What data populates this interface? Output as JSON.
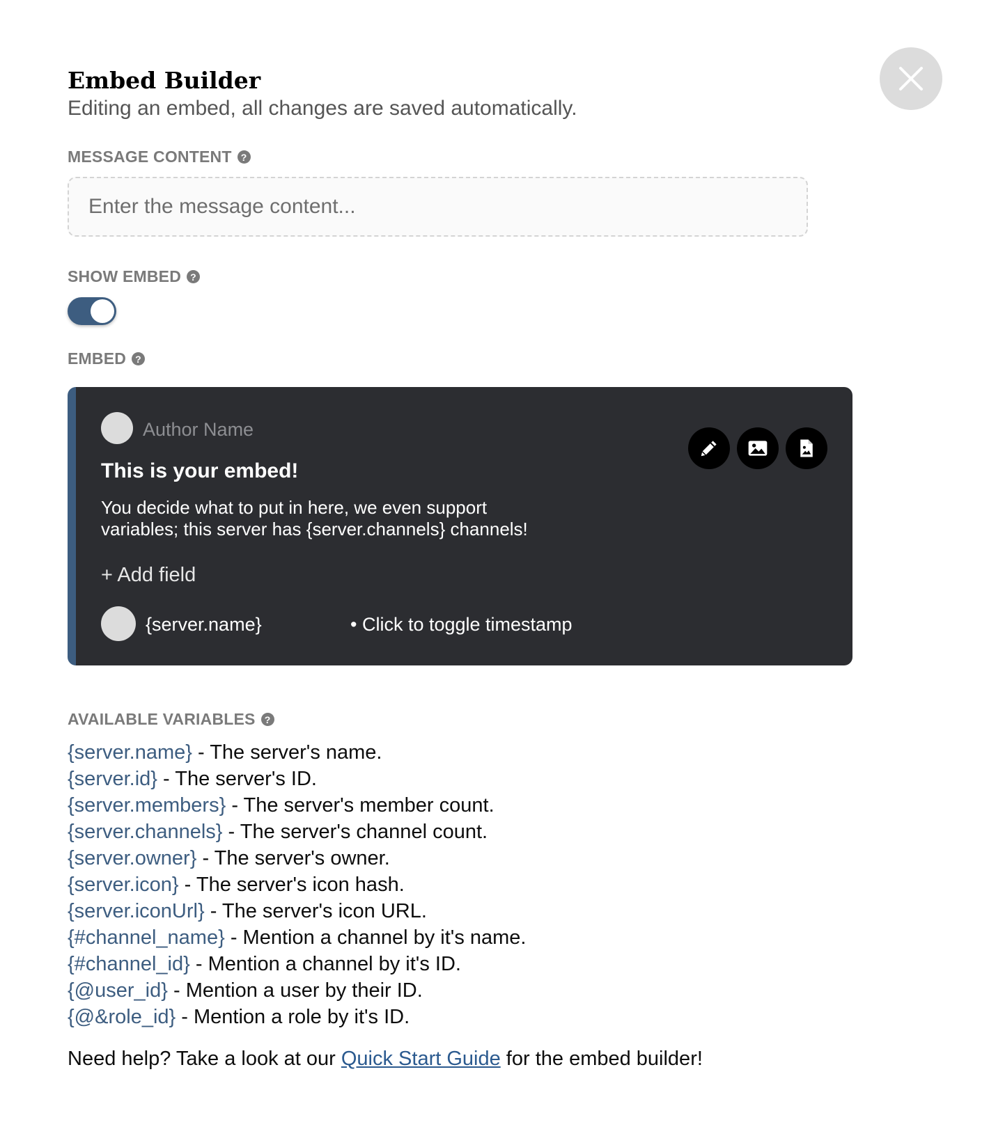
{
  "header": {
    "title": "Embed Builder",
    "subtitle": "Editing an embed, all changes are saved automatically."
  },
  "message_content": {
    "label": "MESSAGE CONTENT",
    "placeholder": "Enter the message content...",
    "value": ""
  },
  "show_embed": {
    "label": "SHOW EMBED",
    "enabled": true
  },
  "embed": {
    "label": "EMBED",
    "accent_color": "#3d5d80",
    "author_name": "Author Name",
    "title": "This is your embed!",
    "description_line1": "You decide what to put in here, we even support",
    "description_line2": "variables; this server has {server.channels} channels!",
    "add_field_label": "+ Add field",
    "footer_text": "{server.name}",
    "timestamp_label": "• Click to toggle timestamp",
    "actions": [
      "pencil-icon",
      "image-icon",
      "file-image-icon"
    ]
  },
  "variables": {
    "label": "AVAILABLE VARIABLES",
    "items": [
      {
        "name": "{server.name}",
        "desc": " - The server's name."
      },
      {
        "name": "{server.id}",
        "desc": " - The server's ID."
      },
      {
        "name": "{server.members}",
        "desc": " - The server's member count."
      },
      {
        "name": "{server.channels}",
        "desc": " - The server's channel count."
      },
      {
        "name": "{server.owner}",
        "desc": " - The server's owner."
      },
      {
        "name": "{server.icon}",
        "desc": " - The server's icon hash."
      },
      {
        "name": "{server.iconUrl}",
        "desc": " - The server's icon URL."
      },
      {
        "name": "{#channel_name}",
        "desc": " - Mention a channel by it's name."
      },
      {
        "name": "{#channel_id}",
        "desc": " - Mention a channel by it's ID."
      },
      {
        "name": "{@user_id}",
        "desc": " - Mention a user by their ID."
      },
      {
        "name": "{@&role_id}",
        "desc": " - Mention a role by it's ID."
      }
    ]
  },
  "help": {
    "prefix": "Need help? Take a look at our ",
    "link_text": "Quick Start Guide",
    "suffix": " for the embed builder!"
  },
  "colors": {
    "accent": "#3d5d80",
    "embed_background": "#2c2d31",
    "label_gray": "#7a7a7a"
  }
}
